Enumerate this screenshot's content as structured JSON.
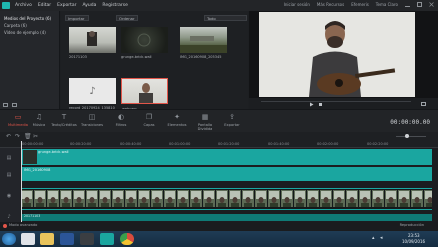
{
  "menu": {
    "items": [
      "Archivo",
      "Editar",
      "Exportar",
      "Ayuda",
      "Registrarse"
    ],
    "right_items": [
      "Iniciar sesión",
      "Más Recursos",
      "Efemeris",
      "Tema Claro"
    ]
  },
  "library": {
    "items": [
      {
        "label": "Medios del Proyecto (6)",
        "active": true
      },
      {
        "label": "Carpeta (6)",
        "active": false
      },
      {
        "label": "Vídeo de ejemplo (4)",
        "active": false
      }
    ]
  },
  "media_toolbar": {
    "import_label": "Importar",
    "sort_label": "Ordenar",
    "filter_label": "Todo",
    "search_placeholder": ""
  },
  "media_items": [
    {
      "caption": "20171103"
    },
    {
      "caption": "grunge-brick-wall"
    },
    {
      "caption": "IMG_20160908_205345"
    },
    {
      "caption": "record_20170924_135810"
    },
    {
      "caption": "webcam"
    }
  ],
  "preview": {
    "timecode": "00:00:00.00"
  },
  "tool_tabs": [
    {
      "icon": "media-icon",
      "label": "Multimedia",
      "active": true
    },
    {
      "icon": "music-icon",
      "label": "Música",
      "active": false
    },
    {
      "icon": "text-icon",
      "label": "Texto/Créditos",
      "active": false
    },
    {
      "icon": "transitions-icon",
      "label": "Transiciones",
      "active": false
    },
    {
      "icon": "filters-icon",
      "label": "Filtros",
      "active": false
    },
    {
      "icon": "overlays-icon",
      "label": "Capas",
      "active": false
    },
    {
      "icon": "elements-icon",
      "label": "Elementos",
      "active": false
    },
    {
      "icon": "split-screen-icon",
      "label": "Pantalla Dividida",
      "active": false
    },
    {
      "icon": "export-icon",
      "label": "Exportar",
      "active": false
    }
  ],
  "timeline": {
    "ruler_ticks": [
      "00:00:00:00",
      "00:00:20:00",
      "00:00:40:00",
      "00:01:00:00",
      "00:01:20:00",
      "00:01:40:00",
      "00:02:00:00",
      "00:02:20:00"
    ],
    "clips": {
      "track1": "grunge-brick-wall",
      "track2": "IMG_20160908",
      "track3": "20171103"
    }
  },
  "status": {
    "left": "Modo avanzado",
    "right": "Reproducción"
  },
  "taskbar": {
    "time": "23:53",
    "date": "10/09/2016"
  },
  "colors": {
    "accent": "#e3564a",
    "teal_track": "#1aa6a0",
    "panel_bg": "#25272b"
  }
}
